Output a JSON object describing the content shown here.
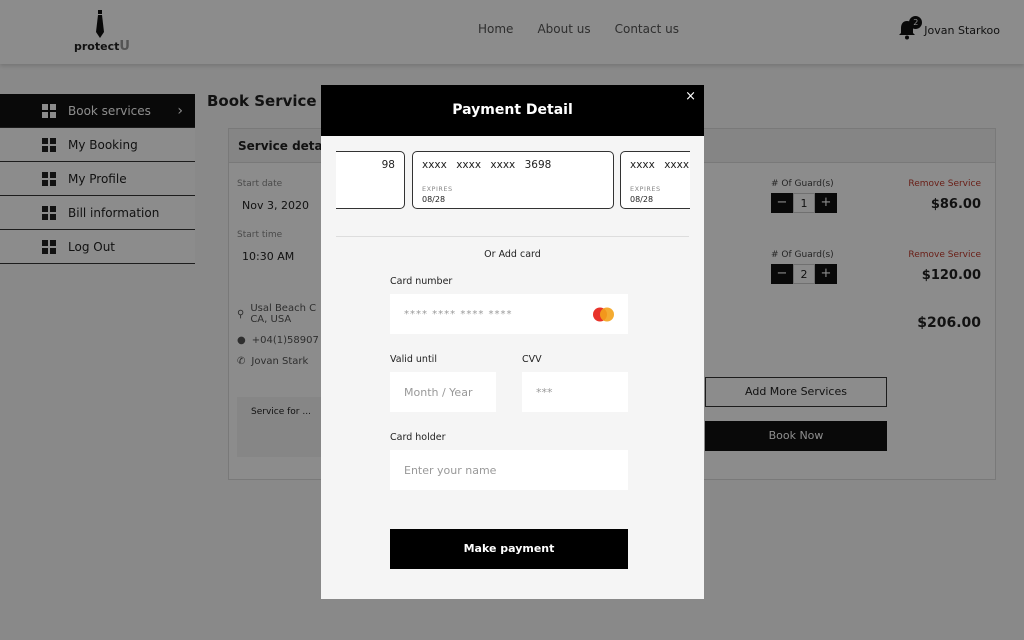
{
  "header": {
    "brand": "protect",
    "brand_suffix": "U",
    "nav": [
      "Home",
      "About us",
      "Contact us"
    ],
    "notifications": "2",
    "user_name": "Jovan Starkoo"
  },
  "sidebar": {
    "items": [
      {
        "label": "Book services"
      },
      {
        "label": "My Booking"
      },
      {
        "label": "My Profile"
      },
      {
        "label": "Bill information"
      },
      {
        "label": "Log Out"
      }
    ]
  },
  "main": {
    "title": "Book Service",
    "panel_title": "Service detail",
    "start_date_label": "Start date",
    "start_date": "Nov 3, 2020",
    "start_time_label": "Start time",
    "start_time": "10:30 AM",
    "address_line1": "Usal Beach C",
    "address_line2": "CA, USA",
    "phone": "+04(1)58907",
    "contact": "Jovan Stark",
    "note": "Service for ...",
    "services": [
      {
        "guards_label": "# Of Guard(s)",
        "remove": "Remove Service",
        "count": "1",
        "price": "$86.00"
      },
      {
        "guards_label": "# Of Guard(s)",
        "remove": "Remove Service",
        "count": "2",
        "price": "$120.00"
      }
    ],
    "total": "$206.00",
    "add_more": "Add More Services",
    "book_now": "Book Now"
  },
  "modal": {
    "title": "Payment Detail",
    "close": "×",
    "cards": [
      {
        "number": "98",
        "expires_label": "",
        "expires": ""
      },
      {
        "number": "xxxx xxxx xxxx 3698",
        "expires_label": "EXPIRES",
        "expires": "08/28"
      },
      {
        "number": "xxxx xxxx",
        "expires_label": "EXPIRES",
        "expires": "08/28"
      }
    ],
    "or_add": "Or Add card",
    "card_number_label": "Card number",
    "card_number_placeholder": "**** **** **** ****",
    "card_brand": "MasterCard",
    "valid_until_label": "Valid until",
    "valid_until_placeholder": "Month / Year",
    "cvv_label": "CVV",
    "cvv_placeholder": "***",
    "holder_label": "Card holder",
    "holder_placeholder": "Enter your name",
    "pay_button": "Make payment"
  }
}
